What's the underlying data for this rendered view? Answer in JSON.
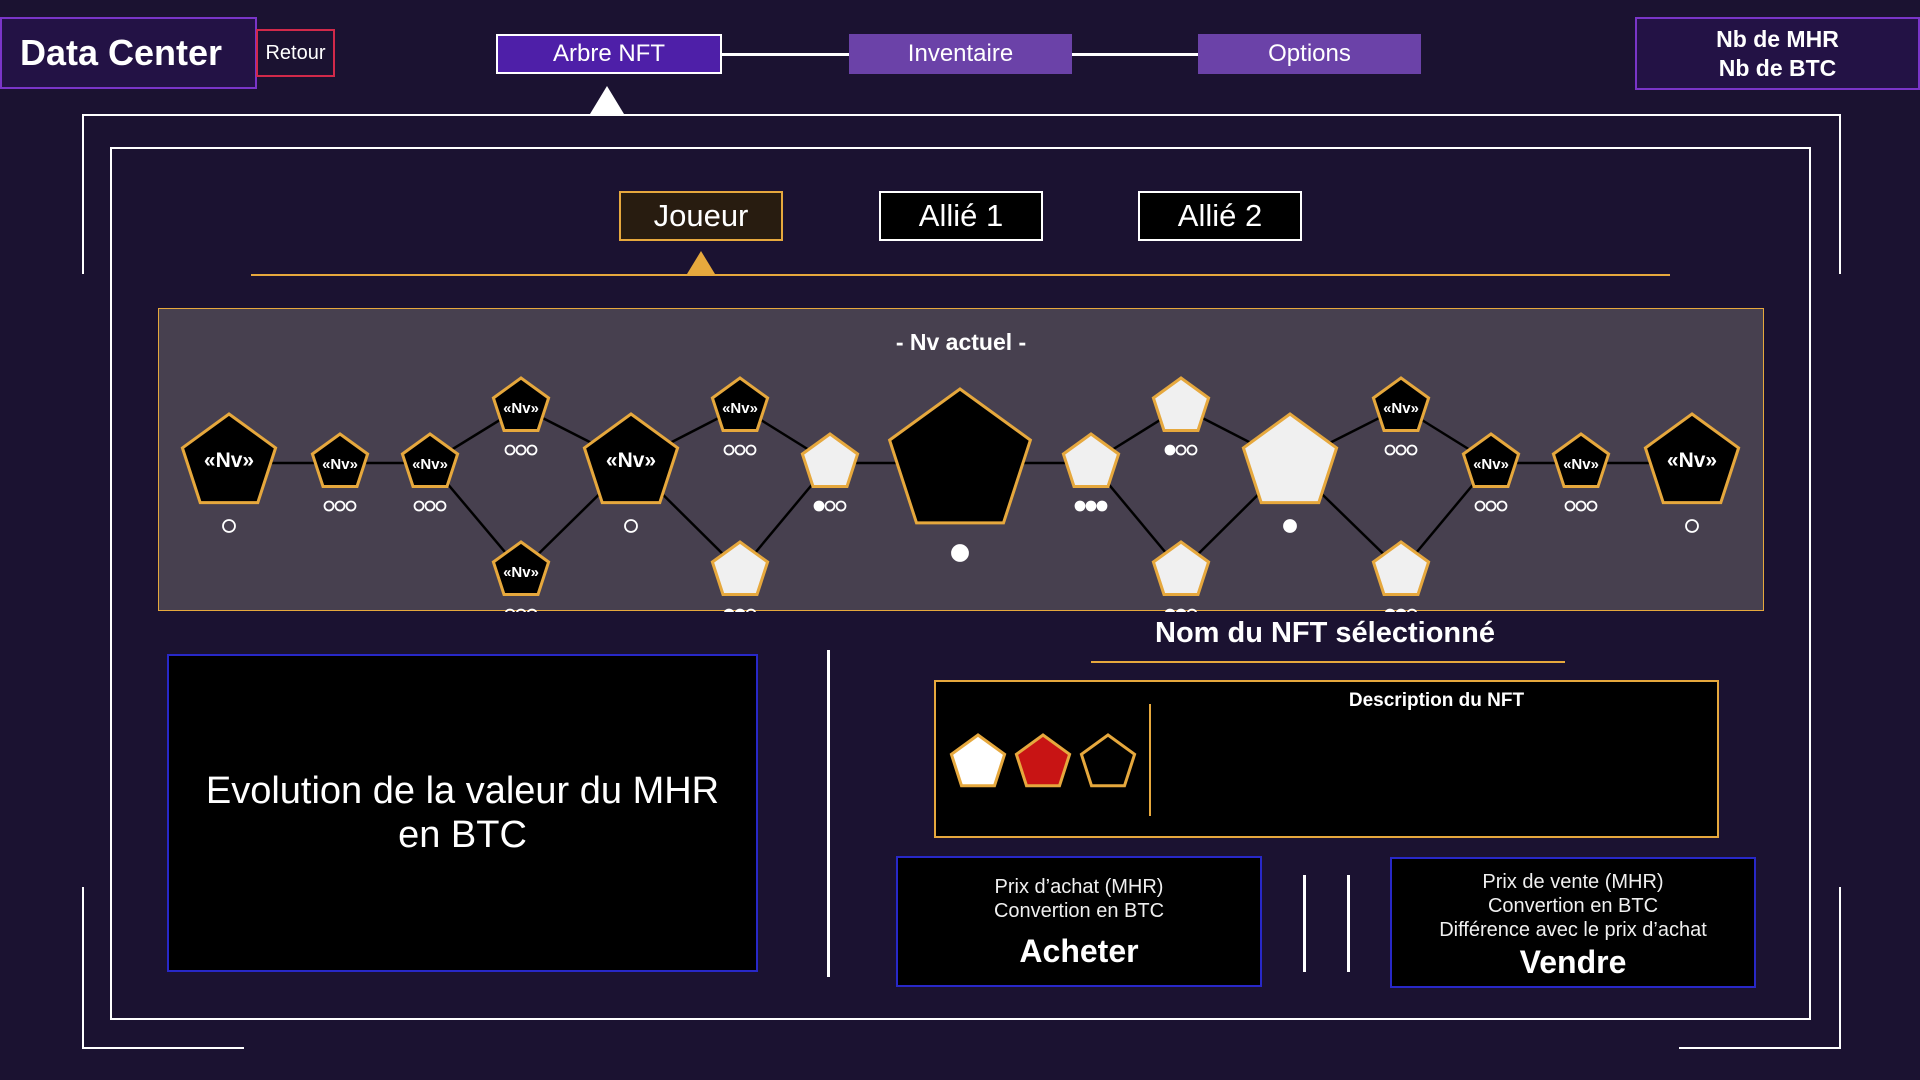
{
  "header": {
    "title": "Data Center",
    "back_label": "Retour",
    "nav_tabs": [
      {
        "label": "Arbre NFT",
        "active": true
      },
      {
        "label": "Inventaire",
        "active": false
      },
      {
        "label": "Options",
        "active": false
      }
    ],
    "currency": {
      "mhr_label": "Nb de MHR",
      "btc_label": "Nb de BTC"
    }
  },
  "character_tabs": [
    {
      "label": "Joueur",
      "active": true
    },
    {
      "label": "Allié 1",
      "active": false
    },
    {
      "label": "Allié 2",
      "active": false
    }
  ],
  "tree": {
    "current_level_label": "- Nv actuel -",
    "node_text": "«Nv»",
    "nodes": [
      {
        "id": "n1",
        "state": "locked",
        "size": "large",
        "text": true,
        "dots": [
          0
        ]
      },
      {
        "id": "n2",
        "state": "locked",
        "size": "small",
        "text": true,
        "dots": [
          0,
          0,
          0
        ]
      },
      {
        "id": "n3",
        "state": "locked",
        "size": "small",
        "text": true,
        "dots": [
          0,
          0,
          0
        ]
      },
      {
        "id": "n4",
        "state": "locked",
        "size": "small",
        "text": true,
        "dots": [
          0,
          0,
          0
        ]
      },
      {
        "id": "n5",
        "state": "locked",
        "size": "small",
        "text": true,
        "dots": [
          0,
          0,
          0
        ]
      },
      {
        "id": "n6",
        "state": "locked",
        "size": "large",
        "text": true,
        "dots": [
          0
        ]
      },
      {
        "id": "n7",
        "state": "locked",
        "size": "small",
        "text": true,
        "dots": [
          0,
          0,
          0
        ]
      },
      {
        "id": "n8",
        "state": "unlocked",
        "size": "small",
        "text": false,
        "dots": [
          1,
          1,
          0
        ]
      },
      {
        "id": "n9",
        "state": "unlocked",
        "size": "small",
        "text": false,
        "dots": [
          1,
          0,
          0
        ]
      },
      {
        "id": "n10",
        "state": "current",
        "size": "xlarge",
        "text": false,
        "dots": [
          1
        ]
      },
      {
        "id": "n11",
        "state": "unlocked",
        "size": "small",
        "text": false,
        "dots": [
          1,
          1,
          1
        ]
      },
      {
        "id": "n12",
        "state": "unlocked",
        "size": "small",
        "text": false,
        "dots": [
          1,
          0,
          0
        ]
      },
      {
        "id": "n13",
        "state": "unlocked",
        "size": "small",
        "text": false,
        "dots": [
          1,
          1,
          0
        ]
      },
      {
        "id": "n14",
        "state": "unlocked",
        "size": "large",
        "text": false,
        "dots": [
          1
        ]
      },
      {
        "id": "n15",
        "state": "locked",
        "size": "small",
        "text": true,
        "dots": [
          0,
          0,
          0
        ]
      },
      {
        "id": "n16",
        "state": "unlocked",
        "size": "small",
        "text": false,
        "dots": [
          1,
          1,
          0
        ]
      },
      {
        "id": "n17",
        "state": "locked",
        "size": "small",
        "text": true,
        "dots": [
          0,
          0,
          0
        ]
      },
      {
        "id": "n18",
        "state": "locked",
        "size": "small",
        "text": true,
        "dots": [
          0,
          0,
          0
        ]
      },
      {
        "id": "n19",
        "state": "locked",
        "size": "large",
        "text": true,
        "dots": [
          0
        ]
      }
    ],
    "edges": [
      [
        "n1",
        "n2"
      ],
      [
        "n2",
        "n3"
      ],
      [
        "n3",
        "n4"
      ],
      [
        "n3",
        "n5"
      ],
      [
        "n4",
        "n6"
      ],
      [
        "n5",
        "n6"
      ],
      [
        "n6",
        "n7"
      ],
      [
        "n6",
        "n8"
      ],
      [
        "n7",
        "n9"
      ],
      [
        "n8",
        "n9"
      ],
      [
        "n9",
        "n10"
      ],
      [
        "n10",
        "n11"
      ],
      [
        "n11",
        "n12"
      ],
      [
        "n11",
        "n13"
      ],
      [
        "n12",
        "n14"
      ],
      [
        "n13",
        "n14"
      ],
      [
        "n14",
        "n15"
      ],
      [
        "n14",
        "n16"
      ],
      [
        "n15",
        "n17"
      ],
      [
        "n16",
        "n17"
      ],
      [
        "n17",
        "n18"
      ],
      [
        "n18",
        "n19"
      ]
    ]
  },
  "chart_box": {
    "text": "Evolution de la valeur du MHR en BTC"
  },
  "nft": {
    "name": "Nom du NFT sélectionné",
    "description_title": "Description du NFT",
    "rarities": [
      {
        "name": "white-rarity-icon",
        "color": "#ffffff"
      },
      {
        "name": "red-rarity-icon",
        "color": "#c81414"
      },
      {
        "name": "black-rarity-icon",
        "color": "#000000"
      }
    ]
  },
  "buy": {
    "price_label": "Prix d’achat (MHR)",
    "conversion_label": "Convertion en BTC",
    "action_label": "Acheter"
  },
  "sell": {
    "price_label": "Prix de vente (MHR)",
    "conversion_label": "Convertion en BTC",
    "difference_label": "Différence avec le prix d’achat",
    "action_label": "Vendre"
  },
  "colors": {
    "background": "#1b1231",
    "accent_gold": "#e6a83d",
    "accent_purple": "#7a35c8",
    "button_blue_border": "#2828c8",
    "tree_panel": "#47404f"
  }
}
